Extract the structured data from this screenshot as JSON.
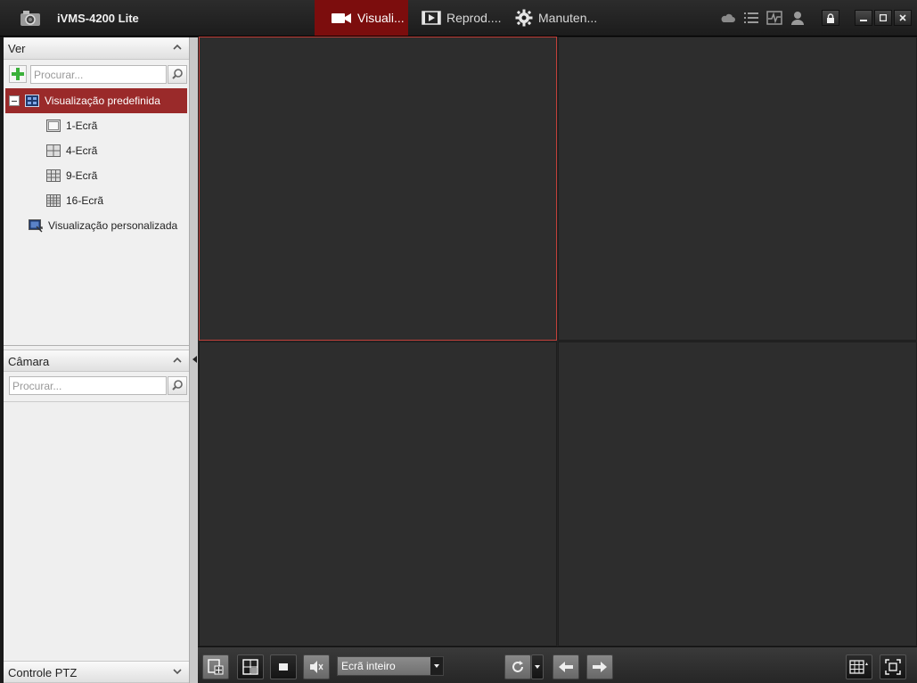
{
  "app": {
    "title": "iVMS-4200 Lite"
  },
  "tabs": [
    {
      "label": "Visuali...",
      "icon": "video-camera-icon",
      "active": true
    },
    {
      "label": "Reprod....",
      "icon": "film-play-icon",
      "active": false
    },
    {
      "label": "Manuten...",
      "icon": "gear-icon",
      "active": false
    }
  ],
  "colors": {
    "accent": "#7c0d0d",
    "selection": "#9a2a2a",
    "cell_highlight": "#c2403a"
  },
  "view_panel": {
    "title": "Ver",
    "search_placeholder": "Procurar...",
    "tree": {
      "root": "Visualização predefinida",
      "children": [
        "1-Ecrã",
        "4-Ecrã",
        "9-Ecrã",
        "16-Ecrã"
      ],
      "custom": "Visualização personalizada"
    }
  },
  "camera_panel": {
    "title": "Câmara",
    "search_placeholder": "Procurar..."
  },
  "ptz_panel": {
    "title": "Controle PTZ"
  },
  "toolbar": {
    "screen_mode": "Ecrã inteiro"
  }
}
